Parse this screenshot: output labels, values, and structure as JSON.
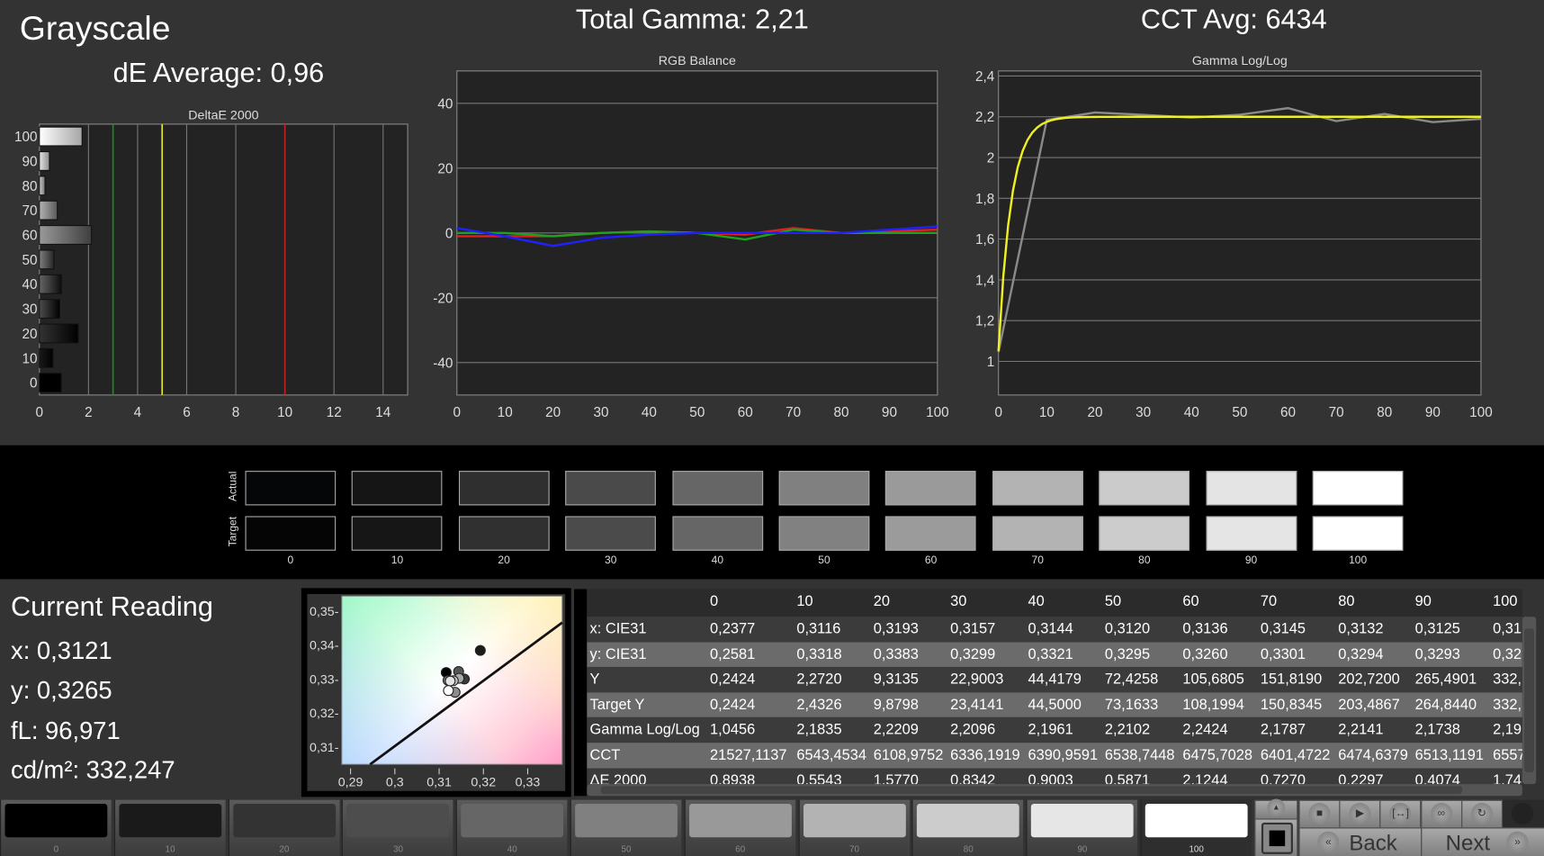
{
  "header": {
    "title": "Grayscale",
    "de_average": "dE Average: 0,96",
    "total_gamma": "Total Gamma: 2,21",
    "cct_avg": "CCT Avg: 6434"
  },
  "chart_data": [
    {
      "type": "bar",
      "title": "DeltaE 2000",
      "orientation": "horizontal",
      "categories": [
        "0",
        "10",
        "20",
        "30",
        "40",
        "50",
        "60",
        "70",
        "80",
        "90",
        "100"
      ],
      "values": [
        0.89,
        0.55,
        1.58,
        0.83,
        0.9,
        0.59,
        2.12,
        0.73,
        0.23,
        0.41,
        1.74
      ],
      "xlim": [
        0,
        15
      ],
      "xticks": [
        "0",
        "2",
        "4",
        "6",
        "8",
        "10",
        "12",
        "14"
      ],
      "reference_lines": [
        {
          "value": 3,
          "color": "#1f8a1f"
        },
        {
          "value": 5,
          "color": "#e8e82a"
        },
        {
          "value": 10,
          "color": "#c02020"
        }
      ],
      "grid": true
    },
    {
      "type": "line",
      "title": "RGB Balance",
      "x": [
        0,
        10,
        20,
        30,
        40,
        50,
        60,
        70,
        80,
        90,
        100
      ],
      "series": [
        {
          "color": "#e02020",
          "values": [
            -1,
            -1,
            -1,
            0,
            0.5,
            0,
            -0.5,
            1.5,
            0,
            0.5,
            1
          ]
        },
        {
          "color": "#20a020",
          "values": [
            0,
            0,
            -1,
            0,
            0.5,
            0,
            -2,
            1,
            0,
            0,
            0
          ]
        },
        {
          "color": "#2020ff",
          "values": [
            1.5,
            -1,
            -4,
            -1.5,
            -0.5,
            0,
            0,
            0,
            0,
            1,
            2
          ]
        }
      ],
      "xlim": [
        0,
        100
      ],
      "ylim": [
        -50,
        50
      ],
      "xticks": [
        "0",
        "10",
        "20",
        "30",
        "40",
        "50",
        "60",
        "70",
        "80",
        "90",
        "100"
      ],
      "yticks": [
        "40",
        "20",
        "0",
        "-20",
        "-40"
      ],
      "grid": true
    },
    {
      "type": "line",
      "title": "Gamma Log/Log",
      "x": [
        0,
        10,
        20,
        30,
        40,
        50,
        60,
        70,
        80,
        90,
        100
      ],
      "series": [
        {
          "color": "#8a8a8a",
          "values": [
            1.0456,
            2.1835,
            2.2209,
            2.2096,
            2.1961,
            2.2102,
            2.2424,
            2.1787,
            2.2141,
            2.1738,
            2.19
          ]
        },
        {
          "color": "#f0f020",
          "curve": "target",
          "values": [
            1.05,
            2.16,
            2.19,
            2.2,
            2.2,
            2.2,
            2.2,
            2.2,
            2.2,
            2.2,
            2.2
          ]
        }
      ],
      "xlim": [
        0,
        100
      ],
      "ylim": [
        0.835,
        2.425
      ],
      "xticks": [
        "0",
        "10",
        "20",
        "30",
        "40",
        "50",
        "60",
        "70",
        "80",
        "90",
        "100"
      ],
      "yticks": [
        "2,4",
        "2,2",
        "2",
        "1,8",
        "1,6",
        "1,4",
        "1,2",
        "1"
      ],
      "grid": true
    },
    {
      "type": "scatter",
      "title": "",
      "xlim": [
        0.288,
        0.3378
      ],
      "ylim": [
        0.3048,
        0.3543
      ],
      "xticks": [
        "0,29",
        "0,3",
        "0,31",
        "0,32",
        "0,33"
      ],
      "yticks": [
        "0,35",
        "0,34",
        "0,33",
        "0,32",
        "0,31"
      ],
      "points": [
        [
          0.3116,
          0.3318
        ],
        [
          0.3193,
          0.3383
        ],
        [
          0.3157,
          0.3299
        ],
        [
          0.3144,
          0.3321
        ],
        [
          0.312,
          0.3295
        ],
        [
          0.3136,
          0.326
        ],
        [
          0.3145,
          0.3301
        ],
        [
          0.3132,
          0.3294
        ],
        [
          0.3125,
          0.3293
        ],
        [
          0.3121,
          0.3265
        ]
      ],
      "target": [
        0.3127,
        0.329
      ],
      "locus": [
        [
          0.2944,
          0.3048
        ],
        [
          0.3378,
          0.3465
        ]
      ]
    }
  ],
  "swatches": {
    "row_labels": [
      "Actual",
      "Target"
    ],
    "labels": [
      "0",
      "10",
      "20",
      "30",
      "40",
      "50",
      "60",
      "70",
      "80",
      "90",
      "100"
    ],
    "actual": [
      "#050608",
      "#151515",
      "#2f2f2f",
      "#4a4a4a",
      "#666666",
      "#808080",
      "#9a9a9a",
      "#b3b3b3",
      "#cbcbcb",
      "#e4e4e4",
      "#ffffff"
    ],
    "target": [
      "#050505",
      "#161616",
      "#303030",
      "#4b4b4b",
      "#666666",
      "#818181",
      "#9b9b9b",
      "#b3b3b3",
      "#cccccc",
      "#e5e5e5",
      "#ffffff"
    ]
  },
  "current_reading": {
    "title": "Current Reading",
    "x": "x: 0,3121",
    "y": "y: 0,3265",
    "fl": "fL: 96,971",
    "cdm2": "cd/m²: 332,247"
  },
  "table": {
    "columns": [
      "",
      "0",
      "10",
      "20",
      "30",
      "40",
      "50",
      "60",
      "70",
      "80",
      "90",
      "100"
    ],
    "rows": [
      [
        "x: CIE31",
        "0,2377",
        "0,3116",
        "0,3193",
        "0,3157",
        "0,3144",
        "0,3120",
        "0,3136",
        "0,3145",
        "0,3132",
        "0,3125",
        "0,31"
      ],
      [
        "y: CIE31",
        "0,2581",
        "0,3318",
        "0,3383",
        "0,3299",
        "0,3321",
        "0,3295",
        "0,3260",
        "0,3301",
        "0,3294",
        "0,3293",
        "0,32"
      ],
      [
        "Y",
        "0,2424",
        "2,2720",
        "9,3135",
        "22,9003",
        "44,4179",
        "72,4258",
        "105,6805",
        "151,8190",
        "202,7200",
        "265,4901",
        "332,"
      ],
      [
        "Target Y",
        "0,2424",
        "2,4326",
        "9,8798",
        "23,4141",
        "44,5000",
        "73,1633",
        "108,1994",
        "150,8345",
        "203,4867",
        "264,8440",
        "332,"
      ],
      [
        "Gamma Log/Log",
        "1,0456",
        "2,1835",
        "2,2209",
        "2,2096",
        "2,1961",
        "2,2102",
        "2,2424",
        "2,1787",
        "2,2141",
        "2,1738",
        "2,19"
      ],
      [
        "CCT",
        "21527,1137",
        "6543,4534",
        "6108,9752",
        "6336,1919",
        "6390,9591",
        "6538,7448",
        "6475,7028",
        "6401,4722",
        "6474,6379",
        "6513,1191",
        "6557"
      ],
      [
        "ΔE 2000",
        "0,8938",
        "0,5543",
        "1,5770",
        "0,8342",
        "0,9003",
        "0,5871",
        "2,1244",
        "0,7270",
        "0,2297",
        "0,4074",
        "1,74"
      ]
    ]
  },
  "patches": {
    "labels": [
      "0",
      "10",
      "20",
      "30",
      "40",
      "50",
      "60",
      "70",
      "80",
      "90",
      "100"
    ],
    "colors": [
      "#000000",
      "#1a1a1a",
      "#333333",
      "#4d4d4d",
      "#666666",
      "#808080",
      "#999999",
      "#b3b3b3",
      "#cccccc",
      "#e6e6e6",
      "#ffffff"
    ],
    "selected": "100"
  },
  "controls": {
    "back_label": "Back",
    "next_label": "Next",
    "icons": [
      "stop-icon",
      "play-icon",
      "range-icon",
      "loop-icon",
      "refresh-icon"
    ]
  }
}
